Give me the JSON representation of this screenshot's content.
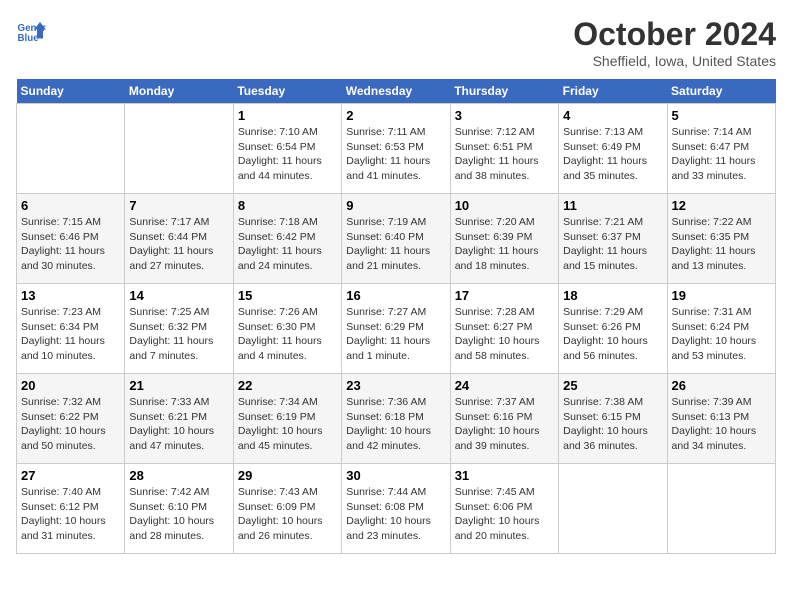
{
  "header": {
    "logo_line1": "General",
    "logo_line2": "Blue",
    "month": "October 2024",
    "location": "Sheffield, Iowa, United States"
  },
  "weekdays": [
    "Sunday",
    "Monday",
    "Tuesday",
    "Wednesday",
    "Thursday",
    "Friday",
    "Saturday"
  ],
  "weeks": [
    [
      {
        "day": "",
        "info": ""
      },
      {
        "day": "",
        "info": ""
      },
      {
        "day": "1",
        "info": "Sunrise: 7:10 AM\nSunset: 6:54 PM\nDaylight: 11 hours and 44 minutes."
      },
      {
        "day": "2",
        "info": "Sunrise: 7:11 AM\nSunset: 6:53 PM\nDaylight: 11 hours and 41 minutes."
      },
      {
        "day": "3",
        "info": "Sunrise: 7:12 AM\nSunset: 6:51 PM\nDaylight: 11 hours and 38 minutes."
      },
      {
        "day": "4",
        "info": "Sunrise: 7:13 AM\nSunset: 6:49 PM\nDaylight: 11 hours and 35 minutes."
      },
      {
        "day": "5",
        "info": "Sunrise: 7:14 AM\nSunset: 6:47 PM\nDaylight: 11 hours and 33 minutes."
      }
    ],
    [
      {
        "day": "6",
        "info": "Sunrise: 7:15 AM\nSunset: 6:46 PM\nDaylight: 11 hours and 30 minutes."
      },
      {
        "day": "7",
        "info": "Sunrise: 7:17 AM\nSunset: 6:44 PM\nDaylight: 11 hours and 27 minutes."
      },
      {
        "day": "8",
        "info": "Sunrise: 7:18 AM\nSunset: 6:42 PM\nDaylight: 11 hours and 24 minutes."
      },
      {
        "day": "9",
        "info": "Sunrise: 7:19 AM\nSunset: 6:40 PM\nDaylight: 11 hours and 21 minutes."
      },
      {
        "day": "10",
        "info": "Sunrise: 7:20 AM\nSunset: 6:39 PM\nDaylight: 11 hours and 18 minutes."
      },
      {
        "day": "11",
        "info": "Sunrise: 7:21 AM\nSunset: 6:37 PM\nDaylight: 11 hours and 15 minutes."
      },
      {
        "day": "12",
        "info": "Sunrise: 7:22 AM\nSunset: 6:35 PM\nDaylight: 11 hours and 13 minutes."
      }
    ],
    [
      {
        "day": "13",
        "info": "Sunrise: 7:23 AM\nSunset: 6:34 PM\nDaylight: 11 hours and 10 minutes."
      },
      {
        "day": "14",
        "info": "Sunrise: 7:25 AM\nSunset: 6:32 PM\nDaylight: 11 hours and 7 minutes."
      },
      {
        "day": "15",
        "info": "Sunrise: 7:26 AM\nSunset: 6:30 PM\nDaylight: 11 hours and 4 minutes."
      },
      {
        "day": "16",
        "info": "Sunrise: 7:27 AM\nSunset: 6:29 PM\nDaylight: 11 hours and 1 minute."
      },
      {
        "day": "17",
        "info": "Sunrise: 7:28 AM\nSunset: 6:27 PM\nDaylight: 10 hours and 58 minutes."
      },
      {
        "day": "18",
        "info": "Sunrise: 7:29 AM\nSunset: 6:26 PM\nDaylight: 10 hours and 56 minutes."
      },
      {
        "day": "19",
        "info": "Sunrise: 7:31 AM\nSunset: 6:24 PM\nDaylight: 10 hours and 53 minutes."
      }
    ],
    [
      {
        "day": "20",
        "info": "Sunrise: 7:32 AM\nSunset: 6:22 PM\nDaylight: 10 hours and 50 minutes."
      },
      {
        "day": "21",
        "info": "Sunrise: 7:33 AM\nSunset: 6:21 PM\nDaylight: 10 hours and 47 minutes."
      },
      {
        "day": "22",
        "info": "Sunrise: 7:34 AM\nSunset: 6:19 PM\nDaylight: 10 hours and 45 minutes."
      },
      {
        "day": "23",
        "info": "Sunrise: 7:36 AM\nSunset: 6:18 PM\nDaylight: 10 hours and 42 minutes."
      },
      {
        "day": "24",
        "info": "Sunrise: 7:37 AM\nSunset: 6:16 PM\nDaylight: 10 hours and 39 minutes."
      },
      {
        "day": "25",
        "info": "Sunrise: 7:38 AM\nSunset: 6:15 PM\nDaylight: 10 hours and 36 minutes."
      },
      {
        "day": "26",
        "info": "Sunrise: 7:39 AM\nSunset: 6:13 PM\nDaylight: 10 hours and 34 minutes."
      }
    ],
    [
      {
        "day": "27",
        "info": "Sunrise: 7:40 AM\nSunset: 6:12 PM\nDaylight: 10 hours and 31 minutes."
      },
      {
        "day": "28",
        "info": "Sunrise: 7:42 AM\nSunset: 6:10 PM\nDaylight: 10 hours and 28 minutes."
      },
      {
        "day": "29",
        "info": "Sunrise: 7:43 AM\nSunset: 6:09 PM\nDaylight: 10 hours and 26 minutes."
      },
      {
        "day": "30",
        "info": "Sunrise: 7:44 AM\nSunset: 6:08 PM\nDaylight: 10 hours and 23 minutes."
      },
      {
        "day": "31",
        "info": "Sunrise: 7:45 AM\nSunset: 6:06 PM\nDaylight: 10 hours and 20 minutes."
      },
      {
        "day": "",
        "info": ""
      },
      {
        "day": "",
        "info": ""
      }
    ]
  ]
}
